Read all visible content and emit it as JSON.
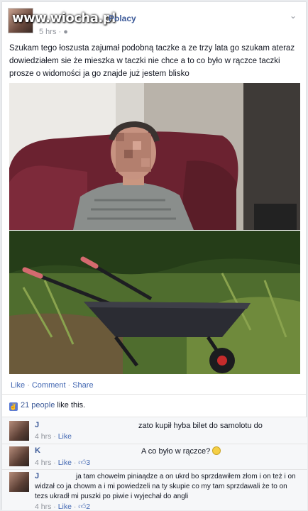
{
  "watermark": "www.wiocha.pl",
  "post": {
    "author": "Polacy",
    "time": "5 hrs",
    "text": "Szukam tego łoszusta zajumał podobną taczke a ze trzy lata go szukam ateraz dowiedziałem sie że mieszka w                    taczki nie chce a to co było w rączce taczki prosze o widomości ja go znajde już jestem blisko"
  },
  "actions": {
    "like": "Like",
    "comment": "Comment",
    "share": "Share"
  },
  "likes": {
    "count": "21 people",
    "suffix": "like this."
  },
  "comments": [
    {
      "name": "J",
      "text": "zato kupił hyba bilet do samolotu do",
      "time": "4 hrs",
      "like": "Like",
      "likes": ""
    },
    {
      "name": "K",
      "text": "A co było w rączce?",
      "time": "4 hrs",
      "like": "Like",
      "likes": "3"
    },
    {
      "name": "J",
      "text": "ja tam chowełm piniaądze a on ukrd bo sprzdawiłem złom i on też i on widzał co ja chowm a i mi powiedzeli na ty skupie co my tam sprzdawali że to on tezs ukradł mi puszki po piwie i wyjechał do angli",
      "time": "4 hrs",
      "like": "Like",
      "likes": "2"
    }
  ],
  "colors": {
    "link": "#3b5998",
    "meta": "#90949c"
  }
}
